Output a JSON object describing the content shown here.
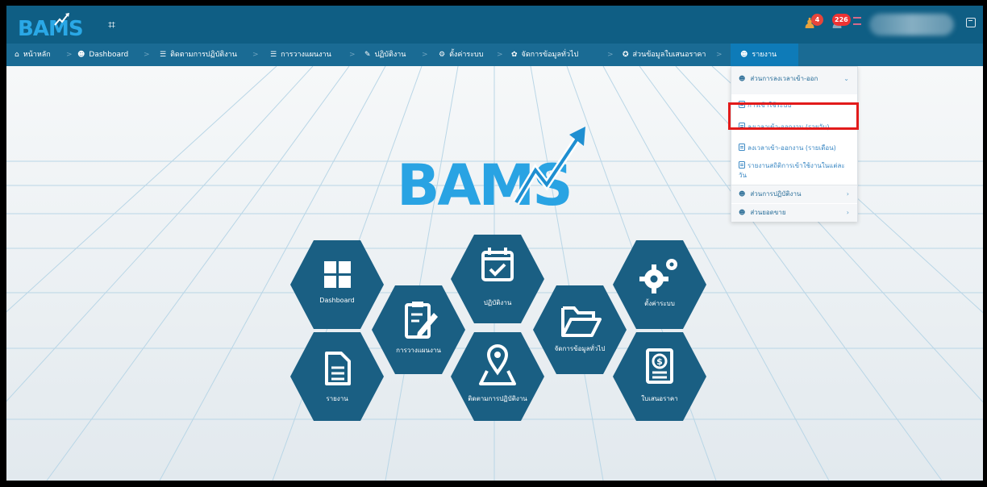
{
  "topbar": {
    "logo_text": "BAMS",
    "menu_toggle_icon": "expand-icon",
    "notifications": [
      {
        "icon": "bell-icon",
        "count": "4"
      },
      {
        "icon": "bell-icon",
        "count": "226"
      }
    ],
    "fullscreen_icon": "fullscreen-icon"
  },
  "nav": {
    "items": [
      {
        "icon": "home-icon",
        "label": "หน้าหลัก"
      },
      {
        "icon": "people-icon",
        "label": "Dashboard"
      },
      {
        "icon": "list-icon",
        "label": "ติดตามการปฏิบัติงาน"
      },
      {
        "icon": "list-icon",
        "label": "การวางแผนงาน"
      },
      {
        "icon": "edit-icon",
        "label": "ปฏิบัติงาน"
      },
      {
        "icon": "gears-icon",
        "label": "ตั้งค่าระบบ"
      },
      {
        "icon": "gear-icon",
        "label": "จัดการข้อมูลทั่วไป"
      },
      {
        "icon": "tag-icon",
        "label": "ส่วนข้อมูลใบเสนอราคา"
      },
      {
        "icon": "people-icon",
        "label": "รายงาน"
      }
    ],
    "separator": ">"
  },
  "main": {
    "logo_text": "BAMS",
    "tiles": [
      {
        "label": "Dashboard",
        "icon": "grid-icon"
      },
      {
        "label": "ปฏิบัติงาน",
        "icon": "calendar-check-icon"
      },
      {
        "label": "ตั้งค่าระบบ",
        "icon": "gears-icon"
      },
      {
        "label": "การวางแผนงาน",
        "icon": "clipboard-edit-icon"
      },
      {
        "label": "จัดการข้อมูลทั่วไป",
        "icon": "folder-open-icon"
      },
      {
        "label": "รายงาน",
        "icon": "document-icon"
      },
      {
        "label": "ติดตามการปฏิบัติงาน",
        "icon": "map-pin-icon"
      },
      {
        "label": "ใบเสนอราคา",
        "icon": "invoice-dollar-icon"
      }
    ]
  },
  "dropdown": {
    "group_time": "ส่วนการลงเวลาเข้า-ออก",
    "items": [
      "การเข้าใช้ระบบ",
      "ลงเวลาเข้า-ออกงาน (รายวัน)",
      "ลงเวลาเข้า-ออกงาน (รายเดือน)",
      "รายงานสถิติการเข้าใช้งานในแต่ละวัน"
    ],
    "group_work": "ส่วนการปฏิบัติงาน",
    "group_sales": "ส่วนยอดขาย"
  },
  "colors": {
    "topbar": "#0f5e84",
    "navbar": "#1a6b94",
    "hex_fill": "#1a5f83",
    "logo_blue": "#29a3e3",
    "highlight": "#e21b1b"
  }
}
